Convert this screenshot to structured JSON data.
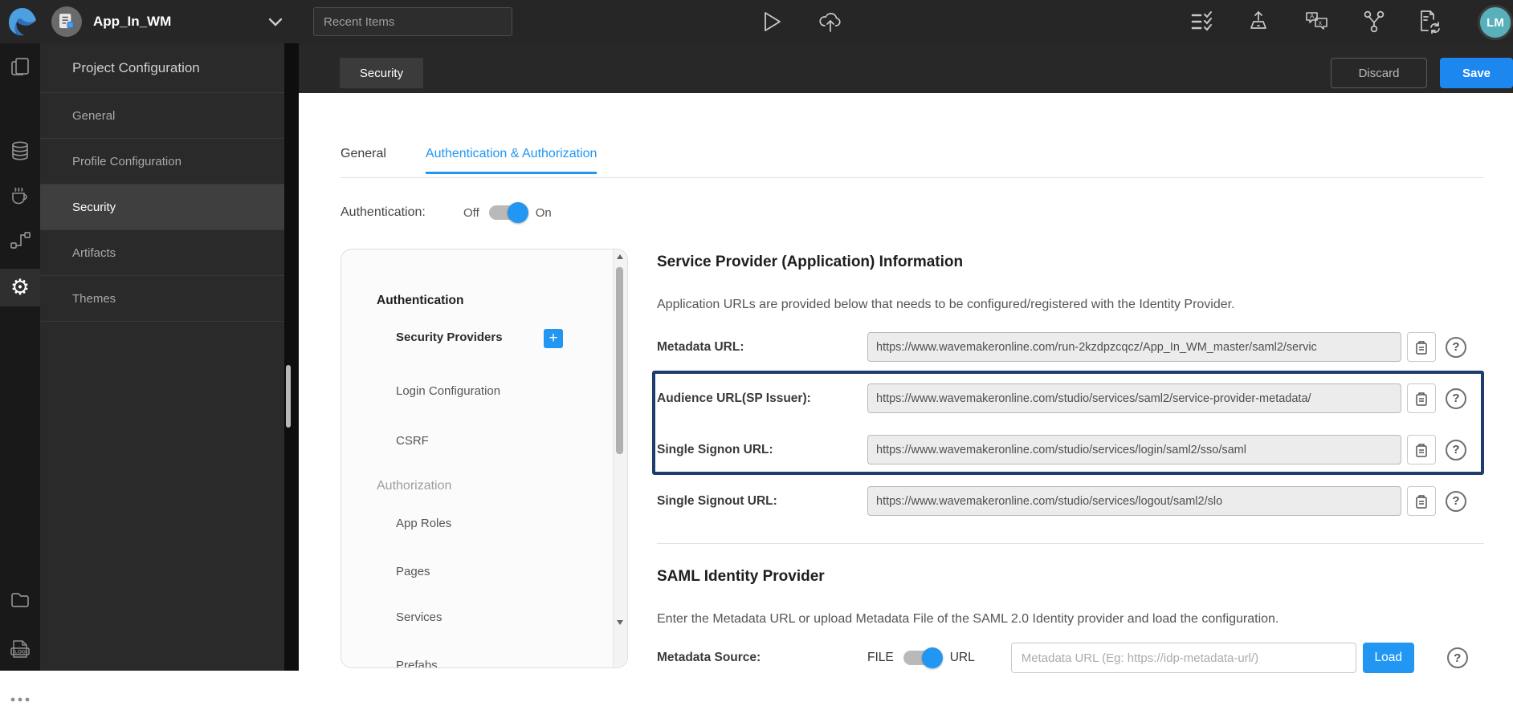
{
  "topbar": {
    "app_name": "App_In_WM",
    "recent_items_placeholder": "Recent Items",
    "avatar_initials": "LM"
  },
  "project_menu": {
    "title": "Project Configuration",
    "items": [
      "General",
      "Profile Configuration",
      "Security",
      "Artifacts",
      "Themes"
    ],
    "active_item": "Security"
  },
  "main_header": {
    "tab_label": "Security",
    "discard_button": "Discard",
    "save_button": "Save"
  },
  "tabs": [
    {
      "label": "General",
      "active": false
    },
    {
      "label": "Authentication & Authorization",
      "active": true
    }
  ],
  "authentication_toggle": {
    "label": "Authentication:",
    "off_label": "Off",
    "on_label": "On",
    "state": "on"
  },
  "security_nav": [
    {
      "type": "header",
      "label": "Authentication"
    },
    {
      "type": "item",
      "label": "Security Providers",
      "selected": true,
      "has_add_button": true
    },
    {
      "type": "item",
      "label": "Login Configuration"
    },
    {
      "type": "item",
      "label": "CSRF"
    },
    {
      "type": "header",
      "label": "Authorization",
      "muted": true
    },
    {
      "type": "item",
      "label": "App Roles"
    },
    {
      "type": "item",
      "label": "Pages"
    },
    {
      "type": "item",
      "label": "Services"
    },
    {
      "type": "item",
      "label": "Prefabs",
      "clipped": true
    }
  ],
  "service_provider_info": {
    "title": "Service Provider (Application) Information",
    "description": "Application URLs are provided below that needs to be configured/registered with the Identity Provider.",
    "fields": [
      {
        "label": "Metadata URL:",
        "value": "https://www.wavemakeronline.com/run-2kzdpzcqcz/App_In_WM_master/saml2/servic",
        "highlighted": false
      },
      {
        "label": "Audience URL(SP Issuer):",
        "value": "https://www.wavemakeronline.com/studio/services/saml2/service-provider-metadata/",
        "highlighted": true
      },
      {
        "label": "Single Signon URL:",
        "value": "https://www.wavemakeronline.com/studio/services/login/saml2/sso/saml",
        "highlighted": true
      },
      {
        "label": "Single Signout URL:",
        "value": "https://www.wavemakeronline.com/studio/services/logout/saml2/slo",
        "highlighted": false
      }
    ]
  },
  "saml_idp": {
    "title": "SAML Identity Provider",
    "description": "Enter the Metadata URL or upload Metadata File of the SAML 2.0 Identity provider and load the configuration.",
    "source_label": "Metadata Source:",
    "file_label": "FILE",
    "url_label": "URL",
    "source_state": "URL",
    "url_placeholder": "Metadata URL (Eg: https://idp-metadata-url/)",
    "load_button": "Load"
  },
  "icons": {
    "topbar": [
      "wavemaker-logo",
      "app-icon",
      "chevron-down-icon",
      "run-icon",
      "deploy-cloud-icon",
      "checklist-icon",
      "export-icon",
      "translate-icon",
      "vcs-branch-icon",
      "file-sync-icon"
    ],
    "rail": [
      "pages-icon",
      "database-icon",
      "java-services-icon",
      "apis-icon",
      "settings-icon",
      "folder-icon",
      "log-icon",
      "more-icon"
    ],
    "field": [
      "copy-icon",
      "help-icon"
    ]
  },
  "colors": {
    "accent_blue": "#2196f3",
    "save_blue": "#1d87f0",
    "highlight_border": "#1c3d6e",
    "topbar_bg": "#262626",
    "rail_bg": "#191919",
    "menu_bg": "#2a2a2a"
  }
}
